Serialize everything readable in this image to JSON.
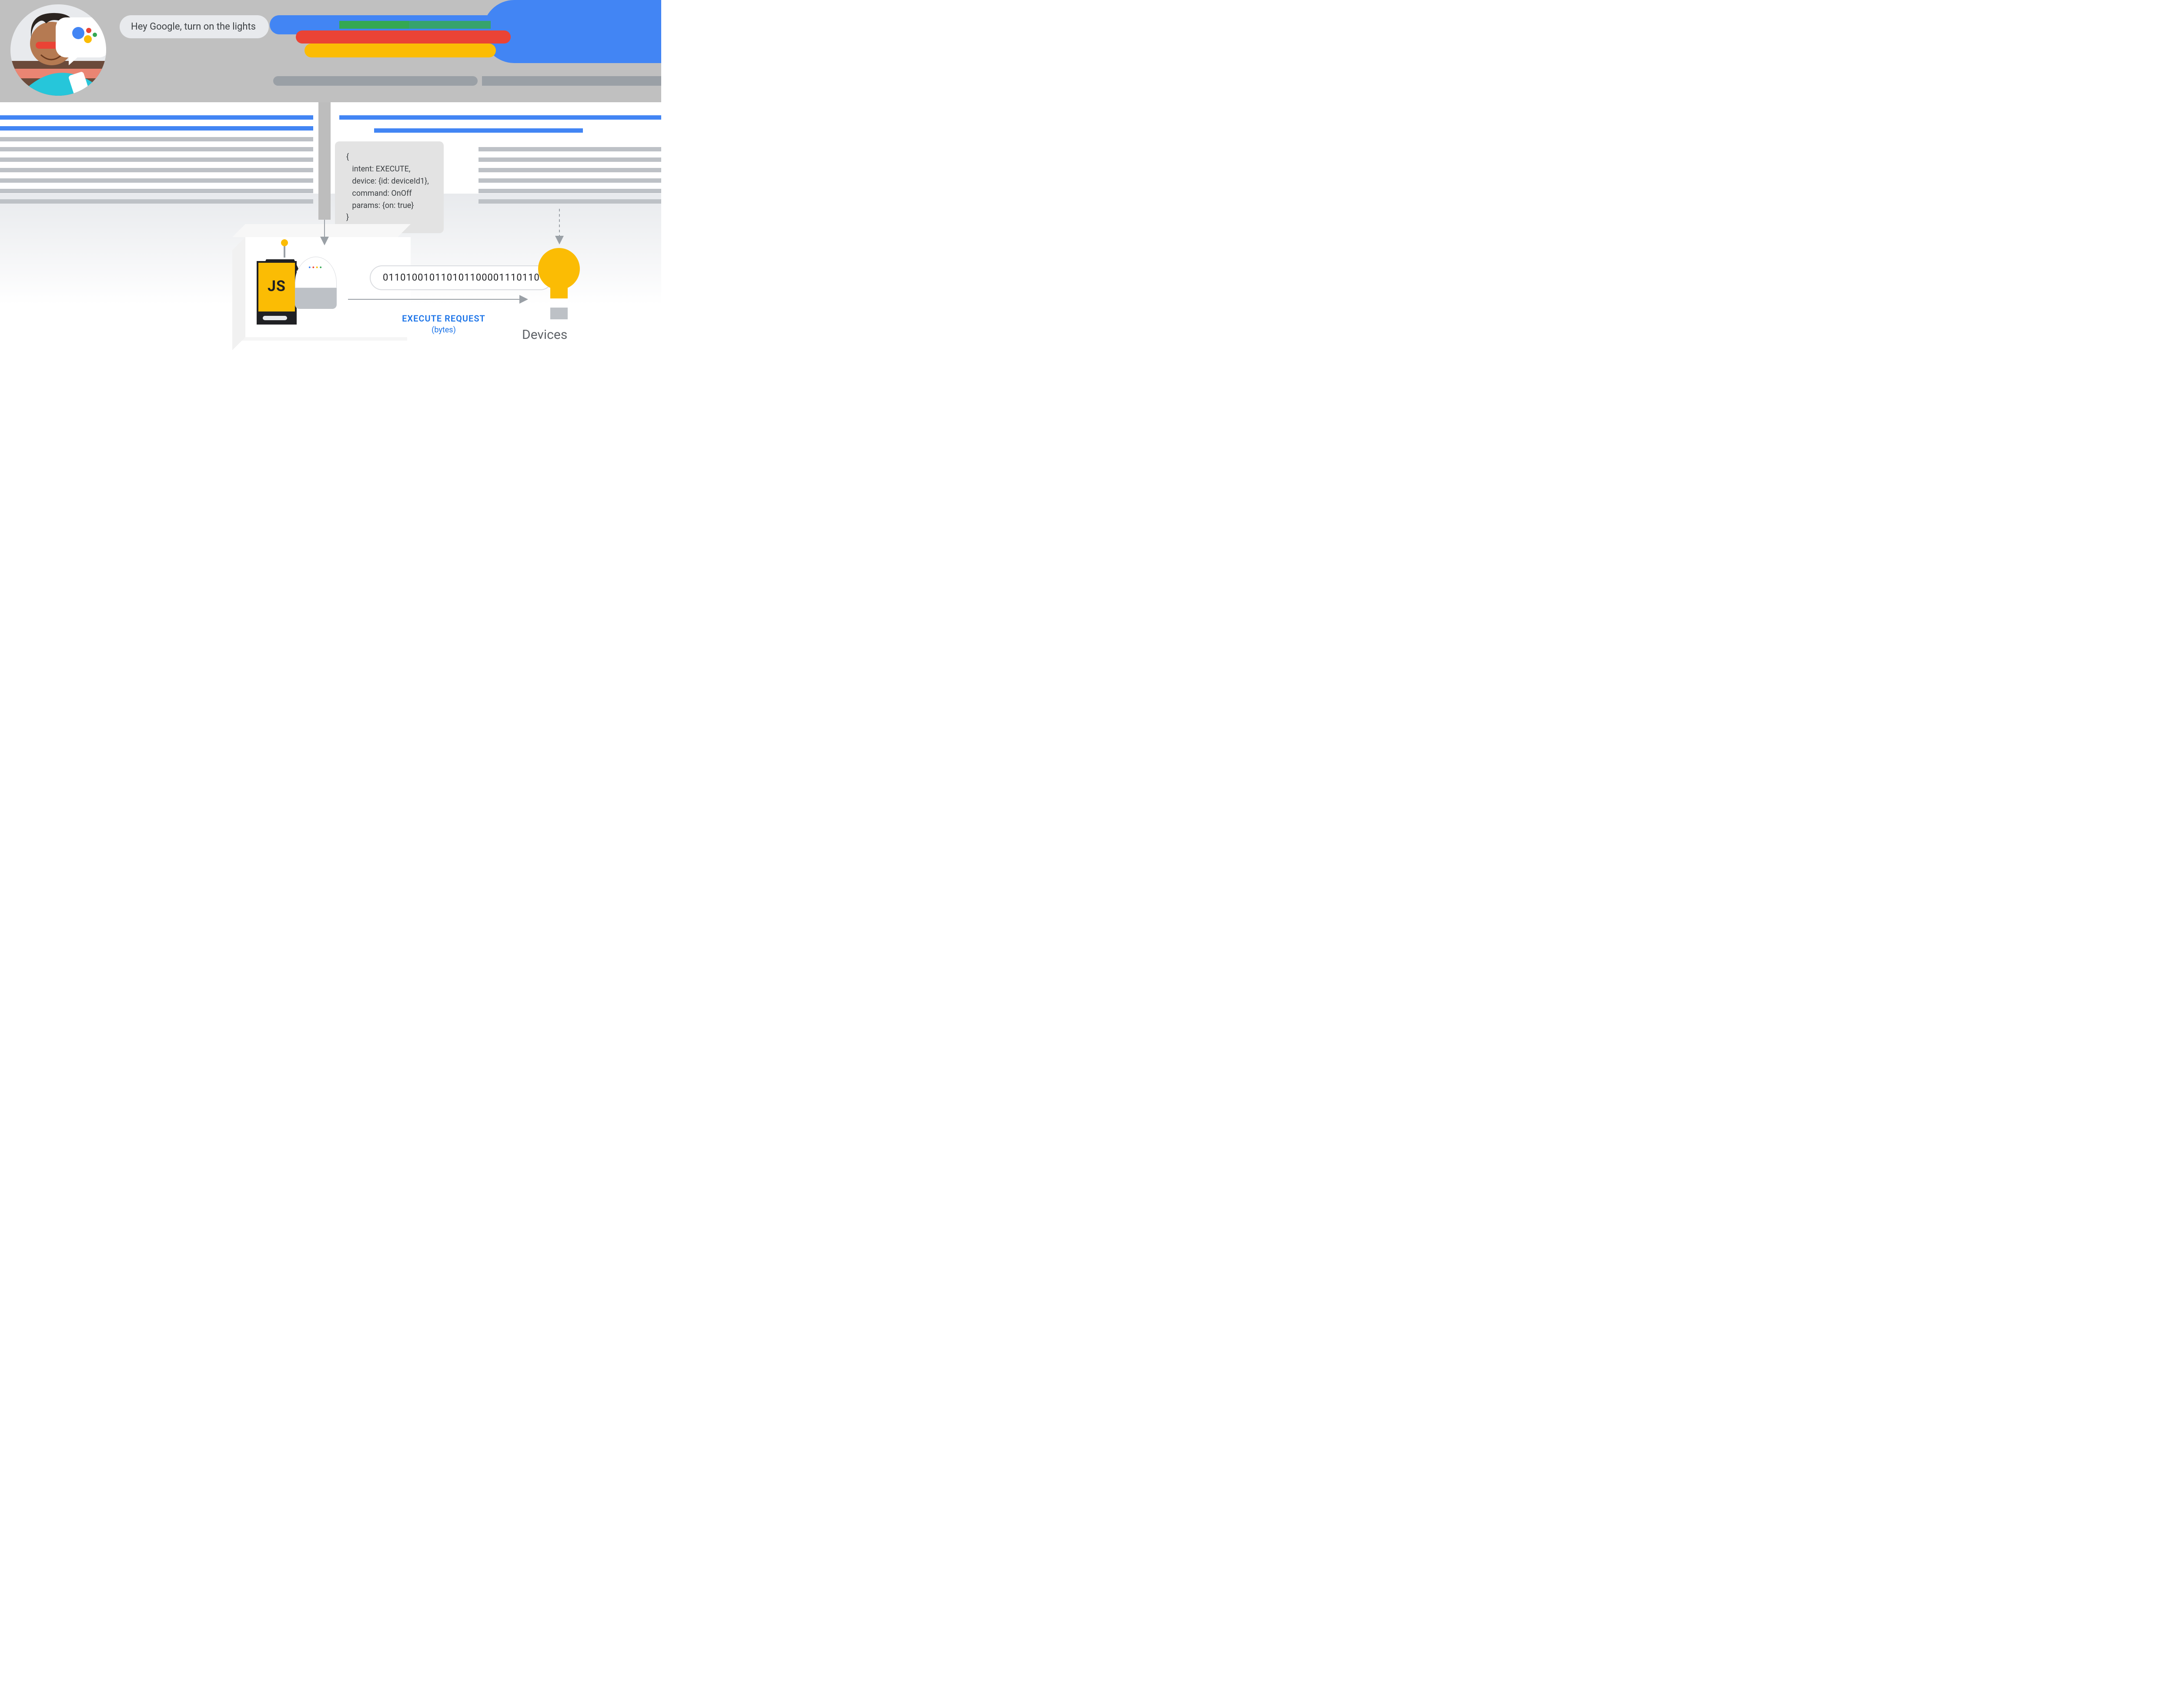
{
  "colors": {
    "blue": "#4285f4",
    "red": "#ea4335",
    "yellow": "#fbbc04",
    "green": "#34a853",
    "grey": "#9aa0a6"
  },
  "speech": {
    "text": "Hey Google, turn on the lights"
  },
  "code": {
    "lines": [
      "{",
      "   intent: EXECUTE,",
      "   device: {id: deviceId1},",
      "   command: OnOff",
      "   params: {on: true}",
      "}"
    ]
  },
  "home": {
    "js_label": "JS"
  },
  "bytes": {
    "value": "011010010110101100001110110"
  },
  "execute": {
    "label": "EXECUTE REQUEST",
    "sub": "(bytes)"
  },
  "devices": {
    "label": "Devices"
  }
}
